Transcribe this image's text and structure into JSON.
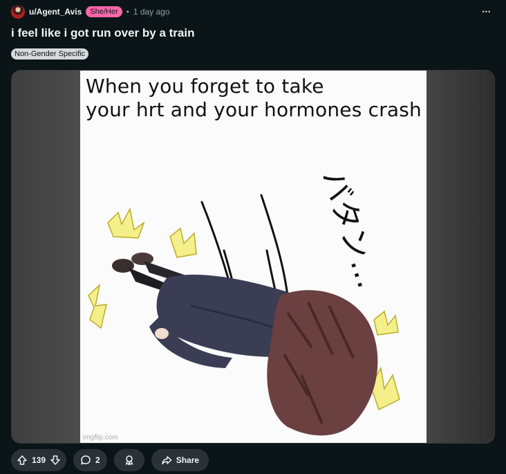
{
  "post": {
    "author": "u/Agent_Avis",
    "user_flair": "She/Her",
    "separator": "•",
    "time_ago": "1 day ago",
    "overflow_label": "•••",
    "title": "i feel like i got run over by a train",
    "post_flair": "Non-Gender Specific"
  },
  "media": {
    "caption": "When you forget to take\nyour hrt and your hormones crash",
    "sound_effect": "バタン…",
    "watermark": "imgflip.com"
  },
  "actions": {
    "score": "139",
    "comments": "2",
    "share_label": "Share"
  },
  "icons": {
    "avatar": "user-avatar",
    "overflow": "more-horizontal-icon",
    "upvote": "upvote-arrow-icon",
    "downvote": "downvote-arrow-icon",
    "comment": "comment-bubble-icon",
    "award": "award-ribbon-icon",
    "share": "share-arrow-icon"
  },
  "colors": {
    "background": "#0b1416",
    "user_flair_bg": "#ff66ac",
    "post_flair_bg": "#d7dadc",
    "pill_bg": "#2a3236"
  }
}
